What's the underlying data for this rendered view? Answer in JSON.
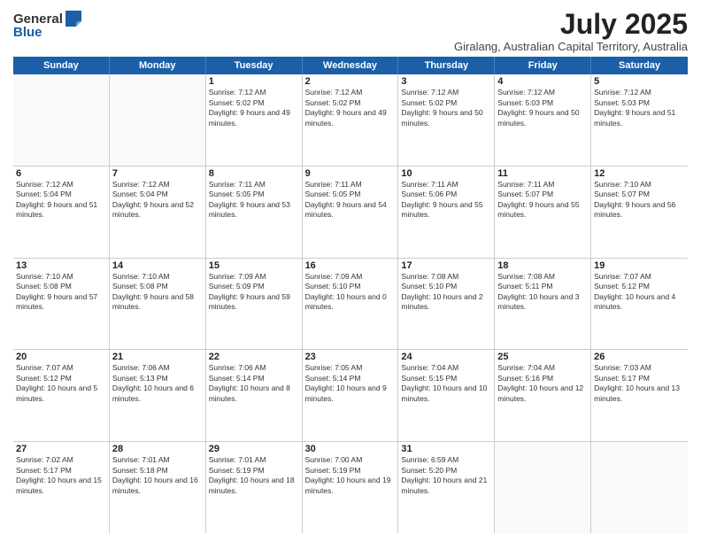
{
  "logo": {
    "general": "General",
    "blue": "Blue"
  },
  "title": "July 2025",
  "subtitle": "Giralang, Australian Capital Territory, Australia",
  "header_days": [
    "Sunday",
    "Monday",
    "Tuesday",
    "Wednesday",
    "Thursday",
    "Friday",
    "Saturday"
  ],
  "weeks": [
    [
      {
        "day": "",
        "info": ""
      },
      {
        "day": "",
        "info": ""
      },
      {
        "day": "1",
        "info": "Sunrise: 7:12 AM\nSunset: 5:02 PM\nDaylight: 9 hours and 49 minutes."
      },
      {
        "day": "2",
        "info": "Sunrise: 7:12 AM\nSunset: 5:02 PM\nDaylight: 9 hours and 49 minutes."
      },
      {
        "day": "3",
        "info": "Sunrise: 7:12 AM\nSunset: 5:02 PM\nDaylight: 9 hours and 50 minutes."
      },
      {
        "day": "4",
        "info": "Sunrise: 7:12 AM\nSunset: 5:03 PM\nDaylight: 9 hours and 50 minutes."
      },
      {
        "day": "5",
        "info": "Sunrise: 7:12 AM\nSunset: 5:03 PM\nDaylight: 9 hours and 51 minutes."
      }
    ],
    [
      {
        "day": "6",
        "info": "Sunrise: 7:12 AM\nSunset: 5:04 PM\nDaylight: 9 hours and 51 minutes."
      },
      {
        "day": "7",
        "info": "Sunrise: 7:12 AM\nSunset: 5:04 PM\nDaylight: 9 hours and 52 minutes."
      },
      {
        "day": "8",
        "info": "Sunrise: 7:11 AM\nSunset: 5:05 PM\nDaylight: 9 hours and 53 minutes."
      },
      {
        "day": "9",
        "info": "Sunrise: 7:11 AM\nSunset: 5:05 PM\nDaylight: 9 hours and 54 minutes."
      },
      {
        "day": "10",
        "info": "Sunrise: 7:11 AM\nSunset: 5:06 PM\nDaylight: 9 hours and 55 minutes."
      },
      {
        "day": "11",
        "info": "Sunrise: 7:11 AM\nSunset: 5:07 PM\nDaylight: 9 hours and 55 minutes."
      },
      {
        "day": "12",
        "info": "Sunrise: 7:10 AM\nSunset: 5:07 PM\nDaylight: 9 hours and 56 minutes."
      }
    ],
    [
      {
        "day": "13",
        "info": "Sunrise: 7:10 AM\nSunset: 5:08 PM\nDaylight: 9 hours and 57 minutes."
      },
      {
        "day": "14",
        "info": "Sunrise: 7:10 AM\nSunset: 5:08 PM\nDaylight: 9 hours and 58 minutes."
      },
      {
        "day": "15",
        "info": "Sunrise: 7:09 AM\nSunset: 5:09 PM\nDaylight: 9 hours and 59 minutes."
      },
      {
        "day": "16",
        "info": "Sunrise: 7:09 AM\nSunset: 5:10 PM\nDaylight: 10 hours and 0 minutes."
      },
      {
        "day": "17",
        "info": "Sunrise: 7:08 AM\nSunset: 5:10 PM\nDaylight: 10 hours and 2 minutes."
      },
      {
        "day": "18",
        "info": "Sunrise: 7:08 AM\nSunset: 5:11 PM\nDaylight: 10 hours and 3 minutes."
      },
      {
        "day": "19",
        "info": "Sunrise: 7:07 AM\nSunset: 5:12 PM\nDaylight: 10 hours and 4 minutes."
      }
    ],
    [
      {
        "day": "20",
        "info": "Sunrise: 7:07 AM\nSunset: 5:12 PM\nDaylight: 10 hours and 5 minutes."
      },
      {
        "day": "21",
        "info": "Sunrise: 7:06 AM\nSunset: 5:13 PM\nDaylight: 10 hours and 6 minutes."
      },
      {
        "day": "22",
        "info": "Sunrise: 7:06 AM\nSunset: 5:14 PM\nDaylight: 10 hours and 8 minutes."
      },
      {
        "day": "23",
        "info": "Sunrise: 7:05 AM\nSunset: 5:14 PM\nDaylight: 10 hours and 9 minutes."
      },
      {
        "day": "24",
        "info": "Sunrise: 7:04 AM\nSunset: 5:15 PM\nDaylight: 10 hours and 10 minutes."
      },
      {
        "day": "25",
        "info": "Sunrise: 7:04 AM\nSunset: 5:16 PM\nDaylight: 10 hours and 12 minutes."
      },
      {
        "day": "26",
        "info": "Sunrise: 7:03 AM\nSunset: 5:17 PM\nDaylight: 10 hours and 13 minutes."
      }
    ],
    [
      {
        "day": "27",
        "info": "Sunrise: 7:02 AM\nSunset: 5:17 PM\nDaylight: 10 hours and 15 minutes."
      },
      {
        "day": "28",
        "info": "Sunrise: 7:01 AM\nSunset: 5:18 PM\nDaylight: 10 hours and 16 minutes."
      },
      {
        "day": "29",
        "info": "Sunrise: 7:01 AM\nSunset: 5:19 PM\nDaylight: 10 hours and 18 minutes."
      },
      {
        "day": "30",
        "info": "Sunrise: 7:00 AM\nSunset: 5:19 PM\nDaylight: 10 hours and 19 minutes."
      },
      {
        "day": "31",
        "info": "Sunrise: 6:59 AM\nSunset: 5:20 PM\nDaylight: 10 hours and 21 minutes."
      },
      {
        "day": "",
        "info": ""
      },
      {
        "day": "",
        "info": ""
      }
    ]
  ]
}
